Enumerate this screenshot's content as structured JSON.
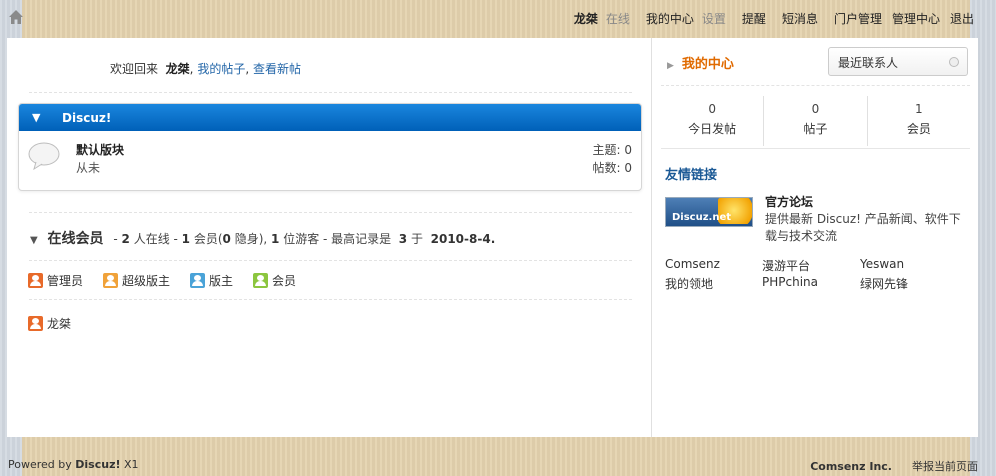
{
  "topbar": {
    "username": "龙桀",
    "status": "在线",
    "my_center": "我的中心",
    "settings": "设置",
    "remind": "提醒",
    "messages": "短消息",
    "portal_admin": "门户管理",
    "admin_center": "管理中心",
    "logout": "退出"
  },
  "welcome": {
    "prefix": "欢迎回来",
    "username": "龙桀",
    "sep1": ",",
    "my_posts": "我的帖子",
    "sep2": ",",
    "new_posts": "查看新帖"
  },
  "forum_group": {
    "title": "Discuz!",
    "forums": [
      {
        "name": "默认版块",
        "last": "从未",
        "topics_label": "主题: 0",
        "posts_label": "帖数: 0"
      }
    ]
  },
  "online": {
    "title": "在线会员",
    "summary_1": "- ",
    "online_count": "2",
    "summary_2": " 人在线  - ",
    "members": "1",
    "summary_3": " 会员(",
    "hidden": "0",
    "summary_4": " 隐身), ",
    "guests": "1",
    "summary_5": " 位游客  - 最高记录是 ",
    "record": "3",
    "summary_6": " 于 ",
    "record_date": "2010-8-4",
    "summary_7": ".",
    "legend": [
      {
        "label": "管理员",
        "color": "#e86a2a"
      },
      {
        "label": "超级版主",
        "color": "#f0a23a"
      },
      {
        "label": "版主",
        "color": "#4aa3d8"
      },
      {
        "label": "会员",
        "color": "#8cc63f"
      }
    ],
    "users": [
      {
        "name": "龙桀",
        "color": "#e86a2a"
      }
    ]
  },
  "side": {
    "my_center": "我的中心",
    "recent_contacts": "最近联系人",
    "stats": [
      {
        "num": "0",
        "label": "今日发帖"
      },
      {
        "num": "0",
        "label": "帖子"
      },
      {
        "num": "1",
        "label": "会员"
      }
    ],
    "friends_title": "友情链接",
    "official_logo_text": "Discuz.net",
    "official_name": "官方论坛",
    "official_desc": "提供最新 Discuz! 产品新闻、软件下载与技术交流",
    "links": [
      "Comsenz",
      "漫游平台",
      "Yeswan",
      "我的领地",
      "PHPchina",
      "绿网先锋"
    ]
  },
  "footer": {
    "powered_prefix": "Powered by ",
    "product": "Discuz!",
    "version": " X1",
    "company": "Comsenz Inc.",
    "report": "举报当前页面"
  }
}
